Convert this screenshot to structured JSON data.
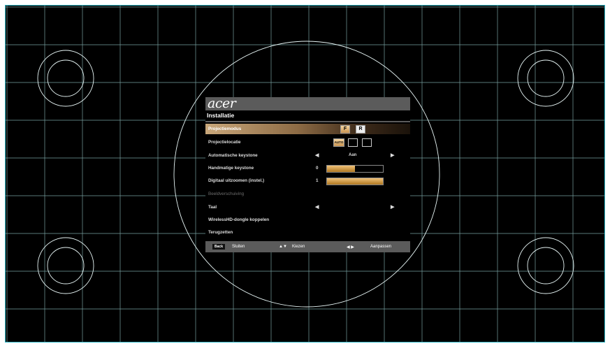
{
  "osd": {
    "brand": "acer",
    "menu_title": "Installatie",
    "rows": [
      {
        "label": "Projectiemodus"
      },
      {
        "label": "Projectielocatie"
      },
      {
        "label": "Automatische keystone",
        "value": "Aan"
      },
      {
        "label": "Handmatige keystone",
        "value": "0",
        "level": 0.5
      },
      {
        "label": "Digitaal uitzoomen (instel.)",
        "value": "1",
        "level": 1.0
      },
      {
        "label": "Beeldverschuiving"
      },
      {
        "label": "Taal"
      },
      {
        "label": "WirelessHD-dongle koppelen"
      },
      {
        "label": "Terugzetten"
      }
    ],
    "projection_mode_icons": [
      "F",
      "R"
    ],
    "projection_location_icons": [
      "AUTO"
    ],
    "footer": {
      "back_key": "Back",
      "back_label": "Sluiten",
      "select_arrows": "▲▼",
      "select_label": "Kiezen",
      "adjust_arrows": "◀ ▶",
      "adjust_label": "Aanpassen"
    }
  },
  "colors": {
    "highlight": "#c9a77a",
    "bar_fill": "#e0a94e",
    "grid_line": "#9fd6d6",
    "header_bg": "#5b5b5b",
    "frame_border": "#2fb8c8"
  }
}
